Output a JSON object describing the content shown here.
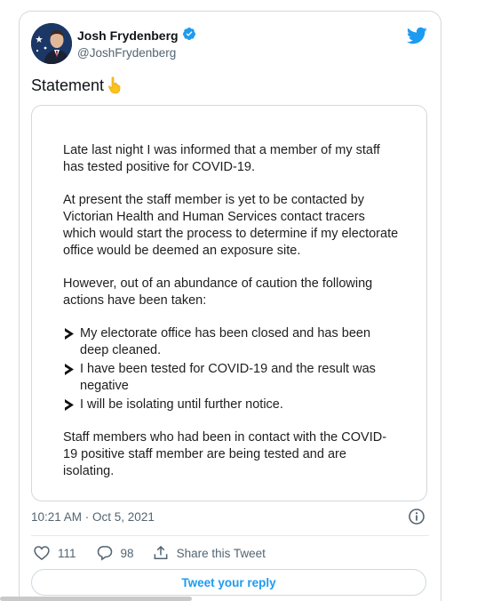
{
  "author": {
    "display_name": "Josh Frydenberg",
    "handle": "@JoshFrydenberg",
    "verified": true
  },
  "tweet": {
    "text": "Statement",
    "emoji": "backhand-index-pointing-down",
    "timestamp": "10:21 AM · Oct 5, 2021"
  },
  "statement_image": {
    "paragraph_1": "Late last night I was informed that a member of my staff has tested positive for COVID-19.",
    "paragraph_2": "At present the staff member is yet to be contacted by Victorian Health and Human Services contact tracers which would start the process to determine if my electorate office would be deemed an exposure site.",
    "paragraph_3": "However, out of an abundance of caution the following actions have been taken:",
    "bullets": [
      "My electorate office has been closed and has been deep cleaned.",
      "I have been tested for COVID-19 and the result was negative",
      "I will be isolating until further notice."
    ],
    "paragraph_4": "Staff members who had been in contact with the COVID-19 positive staff member are being tested and are isolating."
  },
  "actions": {
    "likes": "111",
    "replies": "98",
    "share_label": "Share this Tweet"
  },
  "reply_button": {
    "label": "Tweet your reply"
  },
  "colors": {
    "twitter_blue": "#1d9bf0",
    "secondary_text": "#536471",
    "border": "#d4d8dc"
  }
}
